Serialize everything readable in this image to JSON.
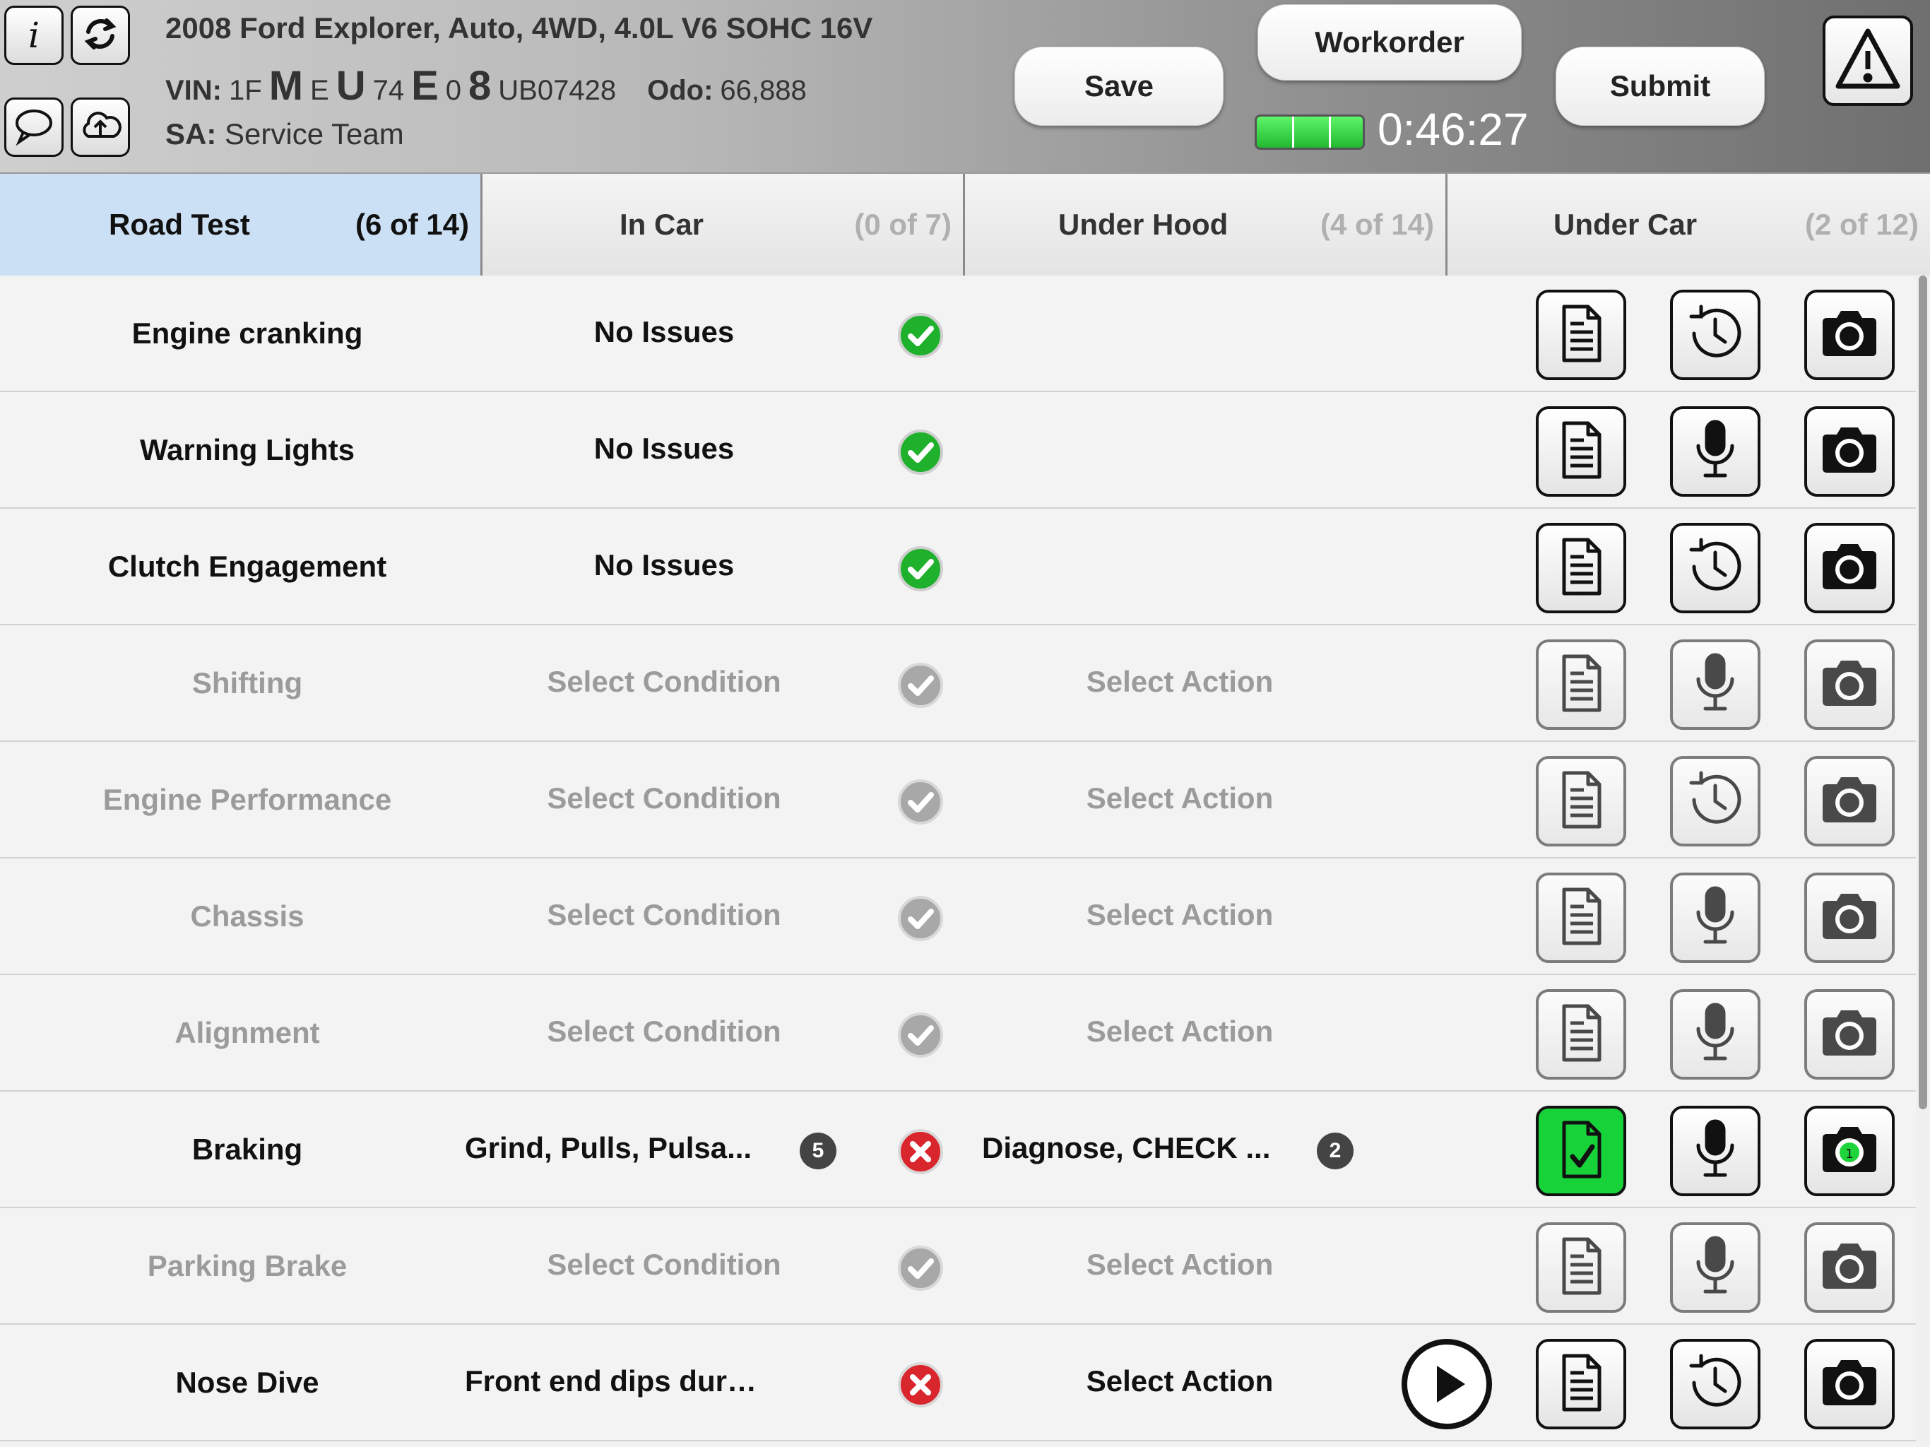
{
  "header": {
    "vehicle": "2008 Ford Explorer, Auto, 4WD, 4.0L V6 SOHC 16V",
    "vin_label": "VIN:",
    "vin_parts": [
      "1F",
      "M",
      "E",
      "U",
      "74",
      "E",
      "0",
      "8",
      "UB07428"
    ],
    "odo_label": "Odo:",
    "odo_value": "66,888",
    "sa_label": "SA:",
    "sa_value": "Service Team",
    "save_label": "Save",
    "workorder_label": "Workorder",
    "submit_label": "Submit",
    "timer": "0:46:27",
    "progress": 1.0,
    "icons": [
      "info-icon",
      "refresh-icon",
      "chat-icon",
      "upload-cloud-icon",
      "warning-icon"
    ]
  },
  "tabs": [
    {
      "label": "Road Test",
      "count": "(6 of 14)",
      "active": true
    },
    {
      "label": "In Car",
      "count": "(0 of 7)",
      "active": false
    },
    {
      "label": "Under Hood",
      "count": "(4 of 14)",
      "active": false
    },
    {
      "label": "Under Car",
      "count": "(2 of 12)",
      "active": false
    }
  ],
  "rows": [
    {
      "name": "Engine cranking",
      "condition": "No Issues",
      "status": "ok",
      "action": "",
      "middle_icon": "history-icon"
    },
    {
      "name": "Warning Lights",
      "condition": "No Issues",
      "status": "ok",
      "action": "",
      "middle_icon": "microphone-icon"
    },
    {
      "name": "Clutch Engagement",
      "condition": "No Issues",
      "status": "ok",
      "action": "",
      "middle_icon": "history-icon"
    },
    {
      "name": "Shifting",
      "condition": "Select Condition",
      "status": "unset",
      "action": "Select Action",
      "middle_icon": "microphone-icon"
    },
    {
      "name": "Engine Performance",
      "condition": "Select Condition",
      "status": "unset",
      "action": "Select Action",
      "middle_icon": "history-icon"
    },
    {
      "name": "Chassis",
      "condition": "Select Condition",
      "status": "unset",
      "action": "Select Action",
      "middle_icon": "microphone-icon"
    },
    {
      "name": "Alignment",
      "condition": "Select Condition",
      "status": "unset",
      "action": "Select Action",
      "middle_icon": "microphone-icon"
    },
    {
      "name": "Braking",
      "condition": "Grind, Pulls, Pulsa...",
      "condition_badge": "5",
      "status": "fail",
      "action": "Diagnose, CHECK ...",
      "action_badge": "2",
      "middle_icon": "microphone-icon",
      "photo_count": "1"
    },
    {
      "name": "Parking Brake",
      "condition": "Select Condition",
      "status": "unset",
      "action": "Select Action",
      "middle_icon": "microphone-icon"
    },
    {
      "name": "Nose Dive",
      "condition": "Front end dips during bra...",
      "status": "fail",
      "action": "Select Action",
      "middle_icon": "history-icon"
    }
  ],
  "colors": {
    "active_tab": "#cce0f5",
    "ok": "#1fb02c",
    "fail": "#d9262c",
    "note_done": "#18d23a"
  }
}
